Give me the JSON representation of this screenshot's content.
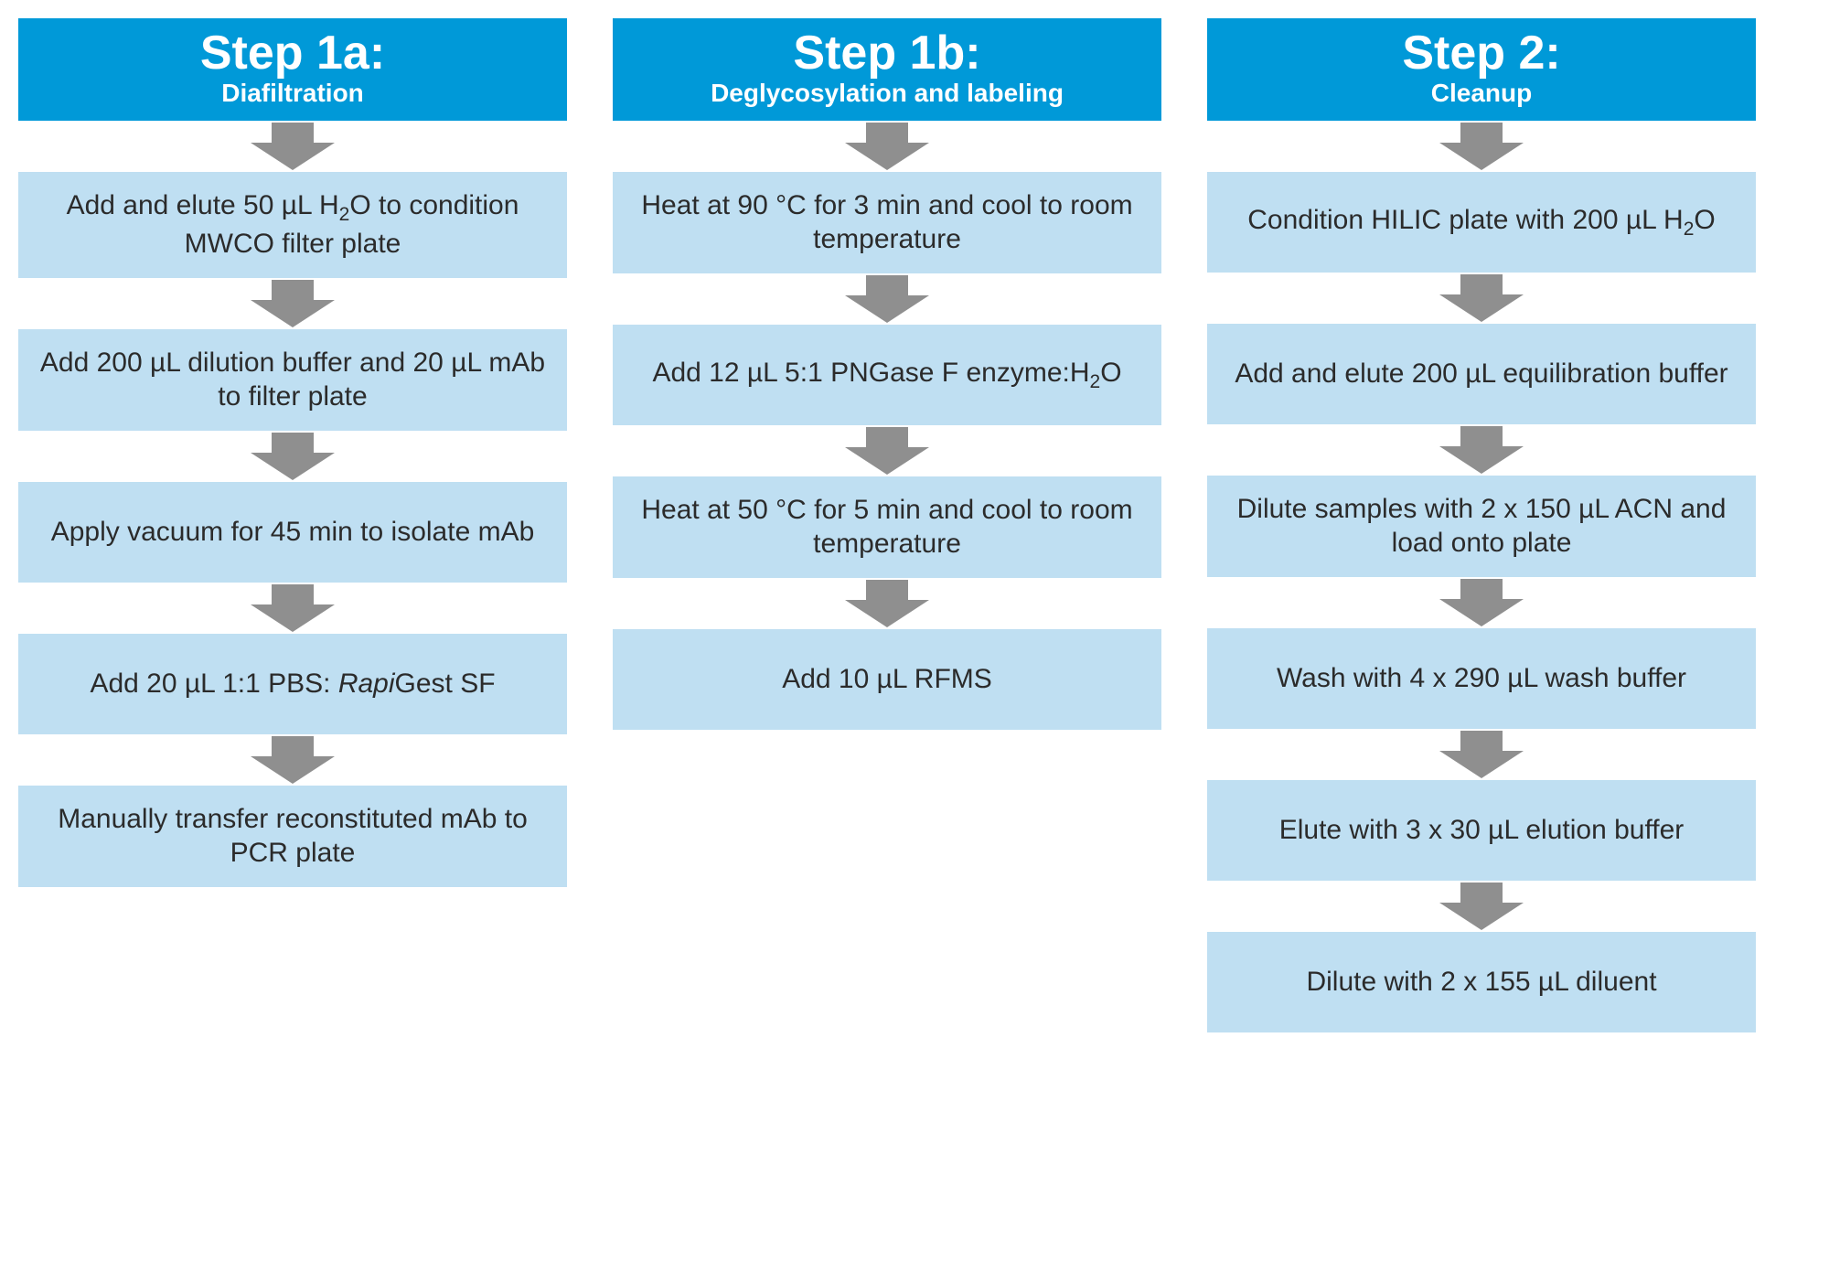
{
  "columns": [
    {
      "header_title": "Step 1a:",
      "header_sub": "Diafiltration",
      "steps": [
        "Add and elute 50 µL H<sub>2</sub>O to condition MWCO filter plate",
        "Add 200 µL dilution buffer and 20 µL mAb to filter plate",
        "Apply vacuum for 45 min to isolate mAb",
        "Add 20 µL 1:1 PBS: <em>Rapi</em>Gest SF",
        "Manually transfer reconstituted mAb to PCR plate"
      ]
    },
    {
      "header_title": "Step 1b:",
      "header_sub": "Deglycosylation and labeling",
      "steps": [
        "Heat at 90 °C for 3 min and cool to room temperature",
        "Add 12 µL 5:1 PNGase F enzyme:H<sub>2</sub>O",
        "Heat at 50 °C for 5 min and cool to room temperature",
        "Add 10 µL RFMS"
      ]
    },
    {
      "header_title": "Step 2:",
      "header_sub": "Cleanup",
      "steps": [
        "Condition HILIC plate with 200 µL H<sub>2</sub>O",
        "Add and elute 200 µL equilibration buffer",
        "Dilute samples with 2 x 150 µL ACN and load onto plate",
        "Wash with 4 x 290 µL wash buffer",
        "Elute with 3 x 30 µL elution buffer",
        "Dilute with 2 x 155 µL diluent"
      ]
    }
  ]
}
